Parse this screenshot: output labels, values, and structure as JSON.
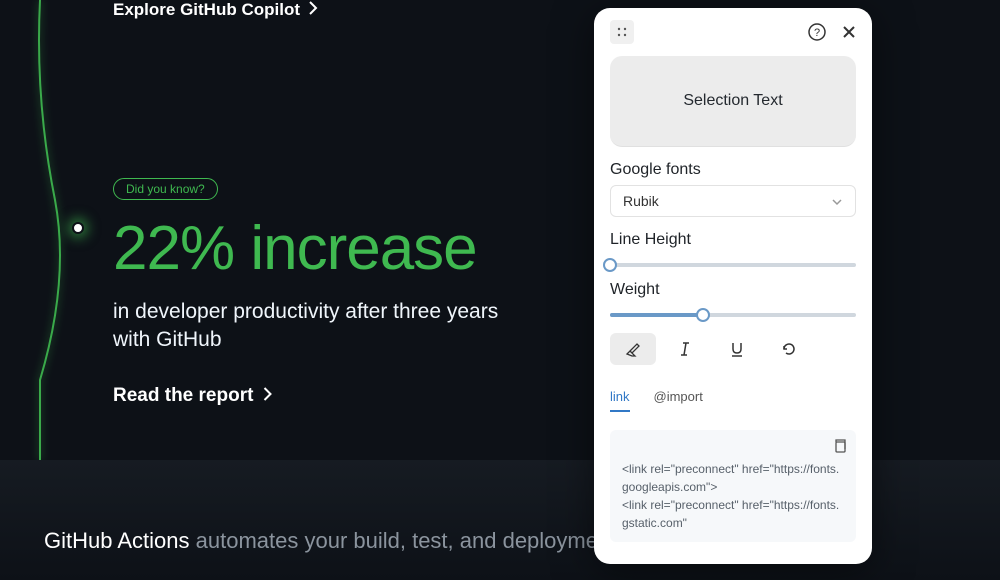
{
  "left": {
    "explore": "Explore GitHub Copilot",
    "pill": "Did you know?",
    "headline": "22% increase",
    "subline": "in developer productivity after three years with GitHub",
    "read": "Read the report"
  },
  "bottom": {
    "strong": "GitHub Actions",
    "rest": " automates your build, test, and deployment workflow with"
  },
  "panel": {
    "selection_text": "Selection Text",
    "google_fonts_label": "Google fonts",
    "font_selected": "Rubik",
    "line_height_label": "Line Height",
    "line_height_value": 0,
    "weight_label": "Weight",
    "weight_value": 38,
    "tabs": {
      "link": "link",
      "import": "@import"
    },
    "code": "<link rel=\"preconnect\" href=\"https://fonts.googleapis.com\">\n<link rel=\"preconnect\" href=\"https://fonts.gstatic.com\""
  }
}
